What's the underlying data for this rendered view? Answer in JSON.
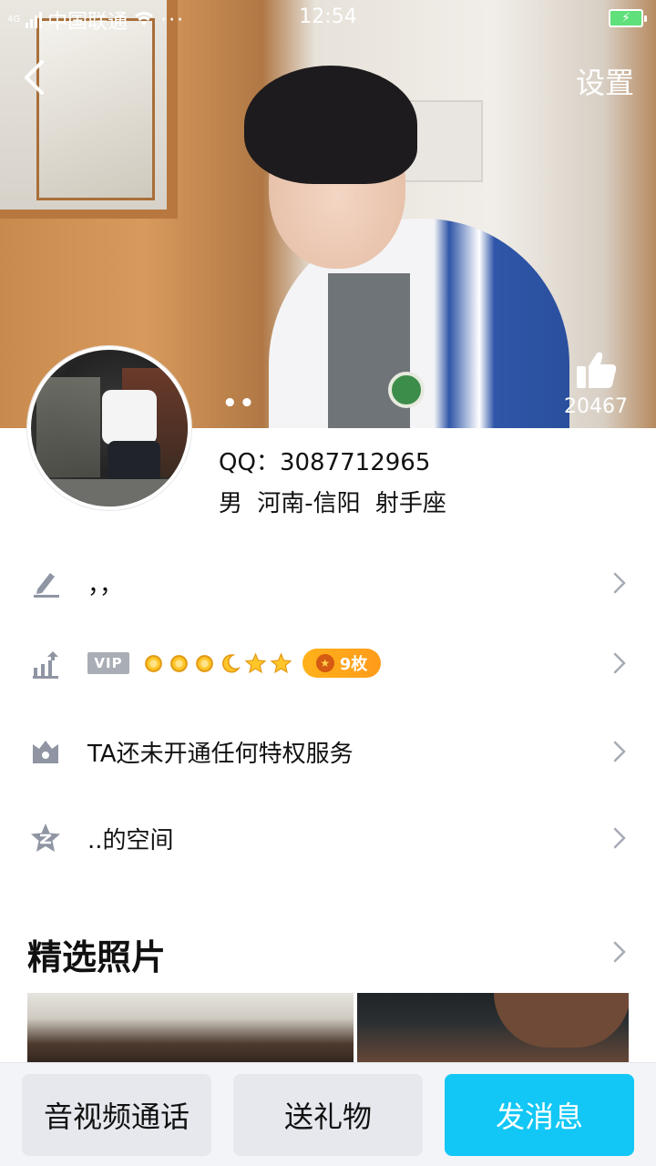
{
  "status_bar": {
    "network": "4G",
    "carrier": "中国联通",
    "time": "12:54",
    "battery_level": 0.9
  },
  "header": {
    "back_icon": "chevron-left-icon",
    "settings_label": "设置",
    "nickname": "••",
    "like_count": "20467",
    "like_icon": "thumbs-up-icon"
  },
  "profile": {
    "qq_label": "QQ：",
    "qq_number": "3087712965",
    "info": "男  河南-信阳  射手座"
  },
  "rows": [
    {
      "icon": "pencil-icon",
      "text": "，，"
    },
    {
      "icon": "level-chart-icon",
      "vip_label": "VIP",
      "level_icons": [
        "sun",
        "sun",
        "sun",
        "moon",
        "star",
        "star"
      ],
      "coin_count": "9枚"
    },
    {
      "icon": "crown-icon",
      "text": "TA还未开通任何特权服务"
    },
    {
      "icon": "qzone-star-icon",
      "text": "..的空间"
    }
  ],
  "photos": {
    "title": "精选照片"
  },
  "bottom_bar": {
    "call_label": "音视频通话",
    "gift_label": "送礼物",
    "message_label": "发消息"
  },
  "colors": {
    "accent": "#12c7f5",
    "coin": "#ff9b1a",
    "icon_gray": "#8f95a3"
  }
}
